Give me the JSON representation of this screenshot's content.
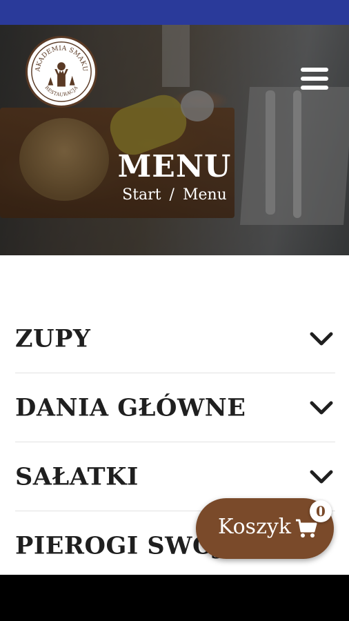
{
  "colors": {
    "statusbar": "#2a3a9a",
    "accent": "#7a4a2a",
    "text": "#1f1f1f"
  },
  "logo": {
    "name_top": "AKADEMIA SMAKU",
    "name_bottom": "RESTAURACJA"
  },
  "hero": {
    "title": "MENU",
    "breadcrumb": {
      "home": "Start",
      "separator": "/",
      "current": "Menu"
    }
  },
  "menu_categories": [
    {
      "label": "ZUPY"
    },
    {
      "label": "DANIA GŁÓWNE"
    },
    {
      "label": "SAŁATKI"
    },
    {
      "label": "PIEROGI SWOJ"
    }
  ],
  "cart": {
    "label": "Koszyk",
    "count": "0",
    "icon": "shopping-cart-icon"
  }
}
